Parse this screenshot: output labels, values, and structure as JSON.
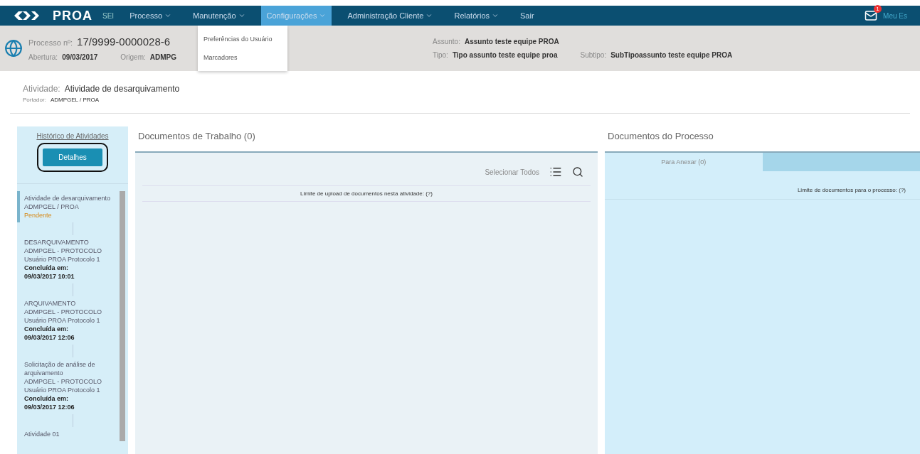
{
  "navbar": {
    "logo": "PROA",
    "logo_sub": "SEI",
    "menu": [
      {
        "label": "Processo",
        "selected": false,
        "has_caret": true
      },
      {
        "label": "Manutenção",
        "selected": false,
        "has_caret": true
      },
      {
        "label": "Configurações",
        "selected": true,
        "has_caret": true
      },
      {
        "label": "Administração Cliente",
        "selected": false,
        "has_caret": true
      },
      {
        "label": "Relatórios",
        "selected": false,
        "has_caret": true
      },
      {
        "label": "Sair",
        "selected": false,
        "has_caret": false
      }
    ],
    "dropdown": [
      "Preferências do Usuário",
      "Marcadores"
    ],
    "notifications": "1",
    "user_link": "Meu Es"
  },
  "process": {
    "number_label": "Processo nº:",
    "number": "17/9999-0000028-6",
    "opening_label": "Abertura:",
    "opening": "09/03/2017",
    "origin_label": "Origem:",
    "origin": "ADMPG",
    "subject_label": "Assunto:",
    "subject": "Assunto teste equipe PROA",
    "type_label": "Tipo:",
    "type": "Tipo assunto teste equipe proa",
    "subtype_label": "Subtipo:",
    "subtype": "SubTipoassunto teste equipe PROA"
  },
  "activity": {
    "label": "Atividade:",
    "name": "Atividade de desarquivamento",
    "holder_label": "Portador:",
    "holder": "ADMPGEL / PROA"
  },
  "history": {
    "title": "Histórico de Atividades",
    "button": "Detalhes",
    "items": [
      {
        "title": "Atividade de desarquivamento",
        "unit": "ADMPGEL / PROA",
        "status": "Pendente",
        "selected": true
      },
      {
        "title": "DESARQUIVAMENTO",
        "unit": "ADMPGEL - PROTOCOLO",
        "user": "Usuário PROA Protocolo 1",
        "status": "Concluída em:",
        "date": "09/03/2017 10:01",
        "selected": false
      },
      {
        "title": "ARQUIVAMENTO",
        "unit": "ADMPGEL - PROTOCOLO",
        "user": "Usuário PROA Protocolo 1",
        "status": "Concluída em:",
        "date": "09/03/2017 12:06",
        "selected": false
      },
      {
        "title": "Solicitação de análise de arquivamento",
        "unit": "ADMPGEL - PROTOCOLO",
        "user": "Usuário PROA Protocolo 1",
        "status": "Concluída em:",
        "date": "09/03/2017 12:06",
        "selected": false
      },
      {
        "title": "Atividade 01",
        "selected": false
      }
    ]
  },
  "work_docs": {
    "title": "Documentos de Trabalho (0)",
    "select_all": "Selecionar Todos",
    "limit": "Limite de upload de documentos nesta atividade: (?)"
  },
  "process_docs": {
    "title": "Documentos do Processo",
    "tabs": [
      {
        "label": "Para Anexar (0)",
        "selected": true
      },
      {
        "selected": false
      }
    ],
    "limit": "Limite de documentos para o processo: (?)"
  }
}
